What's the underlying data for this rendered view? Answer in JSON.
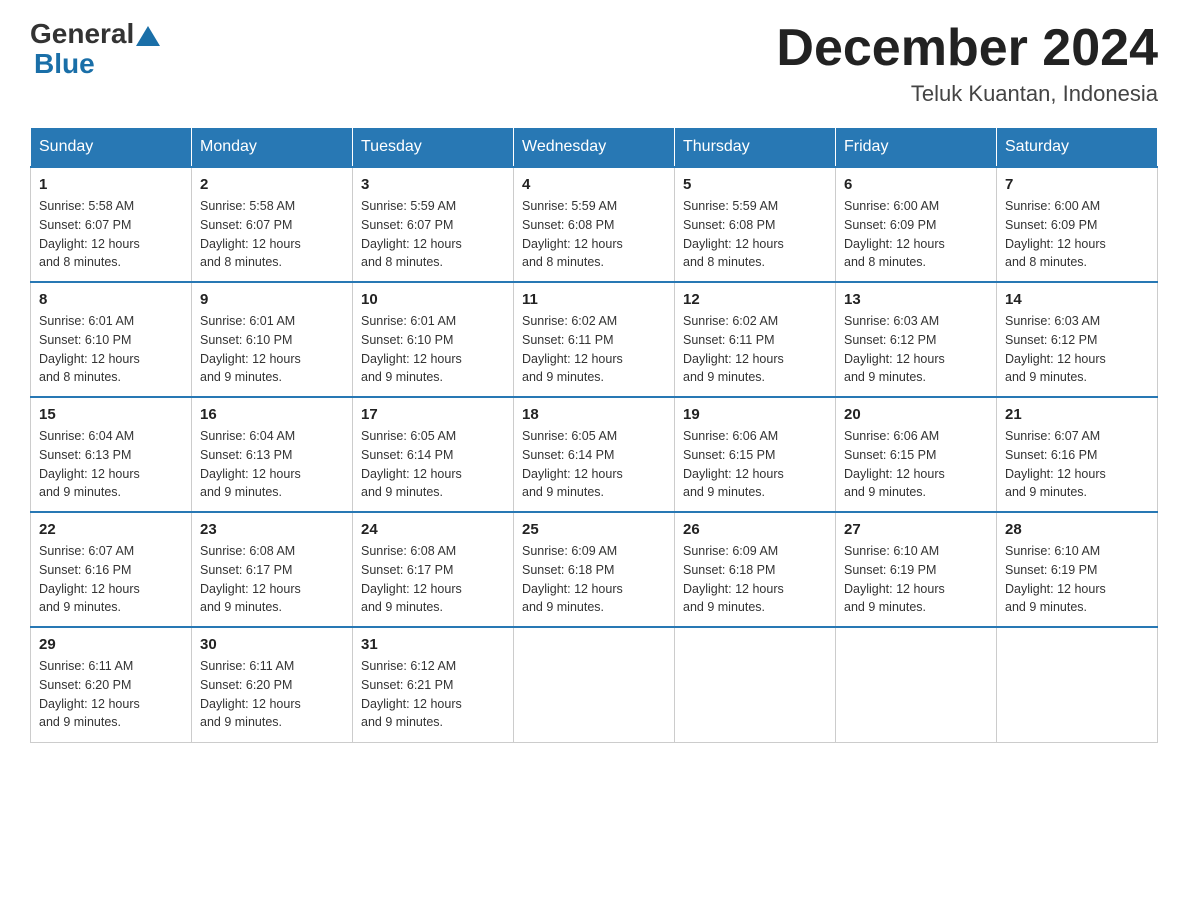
{
  "header": {
    "logo_general": "General",
    "logo_blue": "Blue",
    "month_title": "December 2024",
    "location": "Teluk Kuantan, Indonesia"
  },
  "days_of_week": [
    "Sunday",
    "Monday",
    "Tuesday",
    "Wednesday",
    "Thursday",
    "Friday",
    "Saturday"
  ],
  "weeks": [
    [
      {
        "day": "1",
        "sunrise": "5:58 AM",
        "sunset": "6:07 PM",
        "daylight": "12 hours and 8 minutes."
      },
      {
        "day": "2",
        "sunrise": "5:58 AM",
        "sunset": "6:07 PM",
        "daylight": "12 hours and 8 minutes."
      },
      {
        "day": "3",
        "sunrise": "5:59 AM",
        "sunset": "6:07 PM",
        "daylight": "12 hours and 8 minutes."
      },
      {
        "day": "4",
        "sunrise": "5:59 AM",
        "sunset": "6:08 PM",
        "daylight": "12 hours and 8 minutes."
      },
      {
        "day": "5",
        "sunrise": "5:59 AM",
        "sunset": "6:08 PM",
        "daylight": "12 hours and 8 minutes."
      },
      {
        "day": "6",
        "sunrise": "6:00 AM",
        "sunset": "6:09 PM",
        "daylight": "12 hours and 8 minutes."
      },
      {
        "day": "7",
        "sunrise": "6:00 AM",
        "sunset": "6:09 PM",
        "daylight": "12 hours and 8 minutes."
      }
    ],
    [
      {
        "day": "8",
        "sunrise": "6:01 AM",
        "sunset": "6:10 PM",
        "daylight": "12 hours and 8 minutes."
      },
      {
        "day": "9",
        "sunrise": "6:01 AM",
        "sunset": "6:10 PM",
        "daylight": "12 hours and 9 minutes."
      },
      {
        "day": "10",
        "sunrise": "6:01 AM",
        "sunset": "6:10 PM",
        "daylight": "12 hours and 9 minutes."
      },
      {
        "day": "11",
        "sunrise": "6:02 AM",
        "sunset": "6:11 PM",
        "daylight": "12 hours and 9 minutes."
      },
      {
        "day": "12",
        "sunrise": "6:02 AM",
        "sunset": "6:11 PM",
        "daylight": "12 hours and 9 minutes."
      },
      {
        "day": "13",
        "sunrise": "6:03 AM",
        "sunset": "6:12 PM",
        "daylight": "12 hours and 9 minutes."
      },
      {
        "day": "14",
        "sunrise": "6:03 AM",
        "sunset": "6:12 PM",
        "daylight": "12 hours and 9 minutes."
      }
    ],
    [
      {
        "day": "15",
        "sunrise": "6:04 AM",
        "sunset": "6:13 PM",
        "daylight": "12 hours and 9 minutes."
      },
      {
        "day": "16",
        "sunrise": "6:04 AM",
        "sunset": "6:13 PM",
        "daylight": "12 hours and 9 minutes."
      },
      {
        "day": "17",
        "sunrise": "6:05 AM",
        "sunset": "6:14 PM",
        "daylight": "12 hours and 9 minutes."
      },
      {
        "day": "18",
        "sunrise": "6:05 AM",
        "sunset": "6:14 PM",
        "daylight": "12 hours and 9 minutes."
      },
      {
        "day": "19",
        "sunrise": "6:06 AM",
        "sunset": "6:15 PM",
        "daylight": "12 hours and 9 minutes."
      },
      {
        "day": "20",
        "sunrise": "6:06 AM",
        "sunset": "6:15 PM",
        "daylight": "12 hours and 9 minutes."
      },
      {
        "day": "21",
        "sunrise": "6:07 AM",
        "sunset": "6:16 PM",
        "daylight": "12 hours and 9 minutes."
      }
    ],
    [
      {
        "day": "22",
        "sunrise": "6:07 AM",
        "sunset": "6:16 PM",
        "daylight": "12 hours and 9 minutes."
      },
      {
        "day": "23",
        "sunrise": "6:08 AM",
        "sunset": "6:17 PM",
        "daylight": "12 hours and 9 minutes."
      },
      {
        "day": "24",
        "sunrise": "6:08 AM",
        "sunset": "6:17 PM",
        "daylight": "12 hours and 9 minutes."
      },
      {
        "day": "25",
        "sunrise": "6:09 AM",
        "sunset": "6:18 PM",
        "daylight": "12 hours and 9 minutes."
      },
      {
        "day": "26",
        "sunrise": "6:09 AM",
        "sunset": "6:18 PM",
        "daylight": "12 hours and 9 minutes."
      },
      {
        "day": "27",
        "sunrise": "6:10 AM",
        "sunset": "6:19 PM",
        "daylight": "12 hours and 9 minutes."
      },
      {
        "day": "28",
        "sunrise": "6:10 AM",
        "sunset": "6:19 PM",
        "daylight": "12 hours and 9 minutes."
      }
    ],
    [
      {
        "day": "29",
        "sunrise": "6:11 AM",
        "sunset": "6:20 PM",
        "daylight": "12 hours and 9 minutes."
      },
      {
        "day": "30",
        "sunrise": "6:11 AM",
        "sunset": "6:20 PM",
        "daylight": "12 hours and 9 minutes."
      },
      {
        "day": "31",
        "sunrise": "6:12 AM",
        "sunset": "6:21 PM",
        "daylight": "12 hours and 9 minutes."
      },
      null,
      null,
      null,
      null
    ]
  ],
  "labels": {
    "sunrise": "Sunrise:",
    "sunset": "Sunset:",
    "daylight": "Daylight:"
  }
}
